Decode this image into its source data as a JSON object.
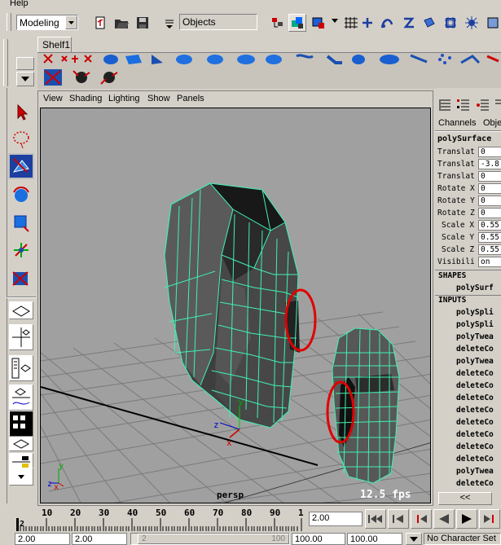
{
  "menu": {
    "help": "Help"
  },
  "status_line": {
    "menu_set": "Modeling",
    "selection_mode": "Objects"
  },
  "shelf": {
    "tab_label": "Shelf1"
  },
  "viewport": {
    "menu": [
      "View",
      "Shading",
      "Lighting",
      "Show",
      "Panels"
    ],
    "camera_label": "persp",
    "fps": "12.5 fps",
    "axis_labels": {
      "x": "x",
      "y": "y",
      "z": "z"
    }
  },
  "channel_box": {
    "tabs": [
      "Channels",
      "Obje"
    ],
    "object_name": "polySurface",
    "channels": [
      {
        "label": "Translat",
        "value": "0"
      },
      {
        "label": "Translat",
        "value": "-3.8"
      },
      {
        "label": "Translat",
        "value": "0"
      },
      {
        "label": "Rotate X",
        "value": "0"
      },
      {
        "label": "Rotate Y",
        "value": "0"
      },
      {
        "label": "Rotate Z",
        "value": "0"
      },
      {
        "label": "Scale X",
        "value": "0.55"
      },
      {
        "label": "Scale Y",
        "value": "0.55"
      },
      {
        "label": "Scale Z",
        "value": "0.55"
      },
      {
        "label": "Visibili",
        "value": "on"
      }
    ],
    "shapes_header": "SHAPES",
    "shapes": [
      "polySurf"
    ],
    "inputs_header": "INPUTS",
    "inputs": [
      "polySpli",
      "polySpli",
      "polyTwea",
      "deleteCo",
      "polyTwea",
      "deleteCo",
      "deleteCo",
      "deleteCo",
      "deleteCo",
      "deleteCo",
      "deleteCo",
      "deleteCo",
      "deleteCo",
      "polyTwea",
      "deleteCo"
    ],
    "scroll_arrow": "<<"
  },
  "time_slider": {
    "ticks": [
      "2",
      "10",
      "20",
      "30",
      "40",
      "50",
      "60",
      "70",
      "80",
      "90",
      "1"
    ],
    "current_time": "2.00"
  },
  "range_slider": {
    "start_time": "2.00",
    "playback_start": "2.00",
    "range_start_label": "2",
    "range_end_label": "100",
    "playback_end": "100.00",
    "end_time": "100.00",
    "character_set": "No Character Set"
  },
  "colors": {
    "ui_gray": "#d4d0c8",
    "viewport_bg": "#a0a0a0",
    "wire_green": "#3ff2b0",
    "highlight_red": "#e00000",
    "selected_blue": "#1c3fa0"
  }
}
